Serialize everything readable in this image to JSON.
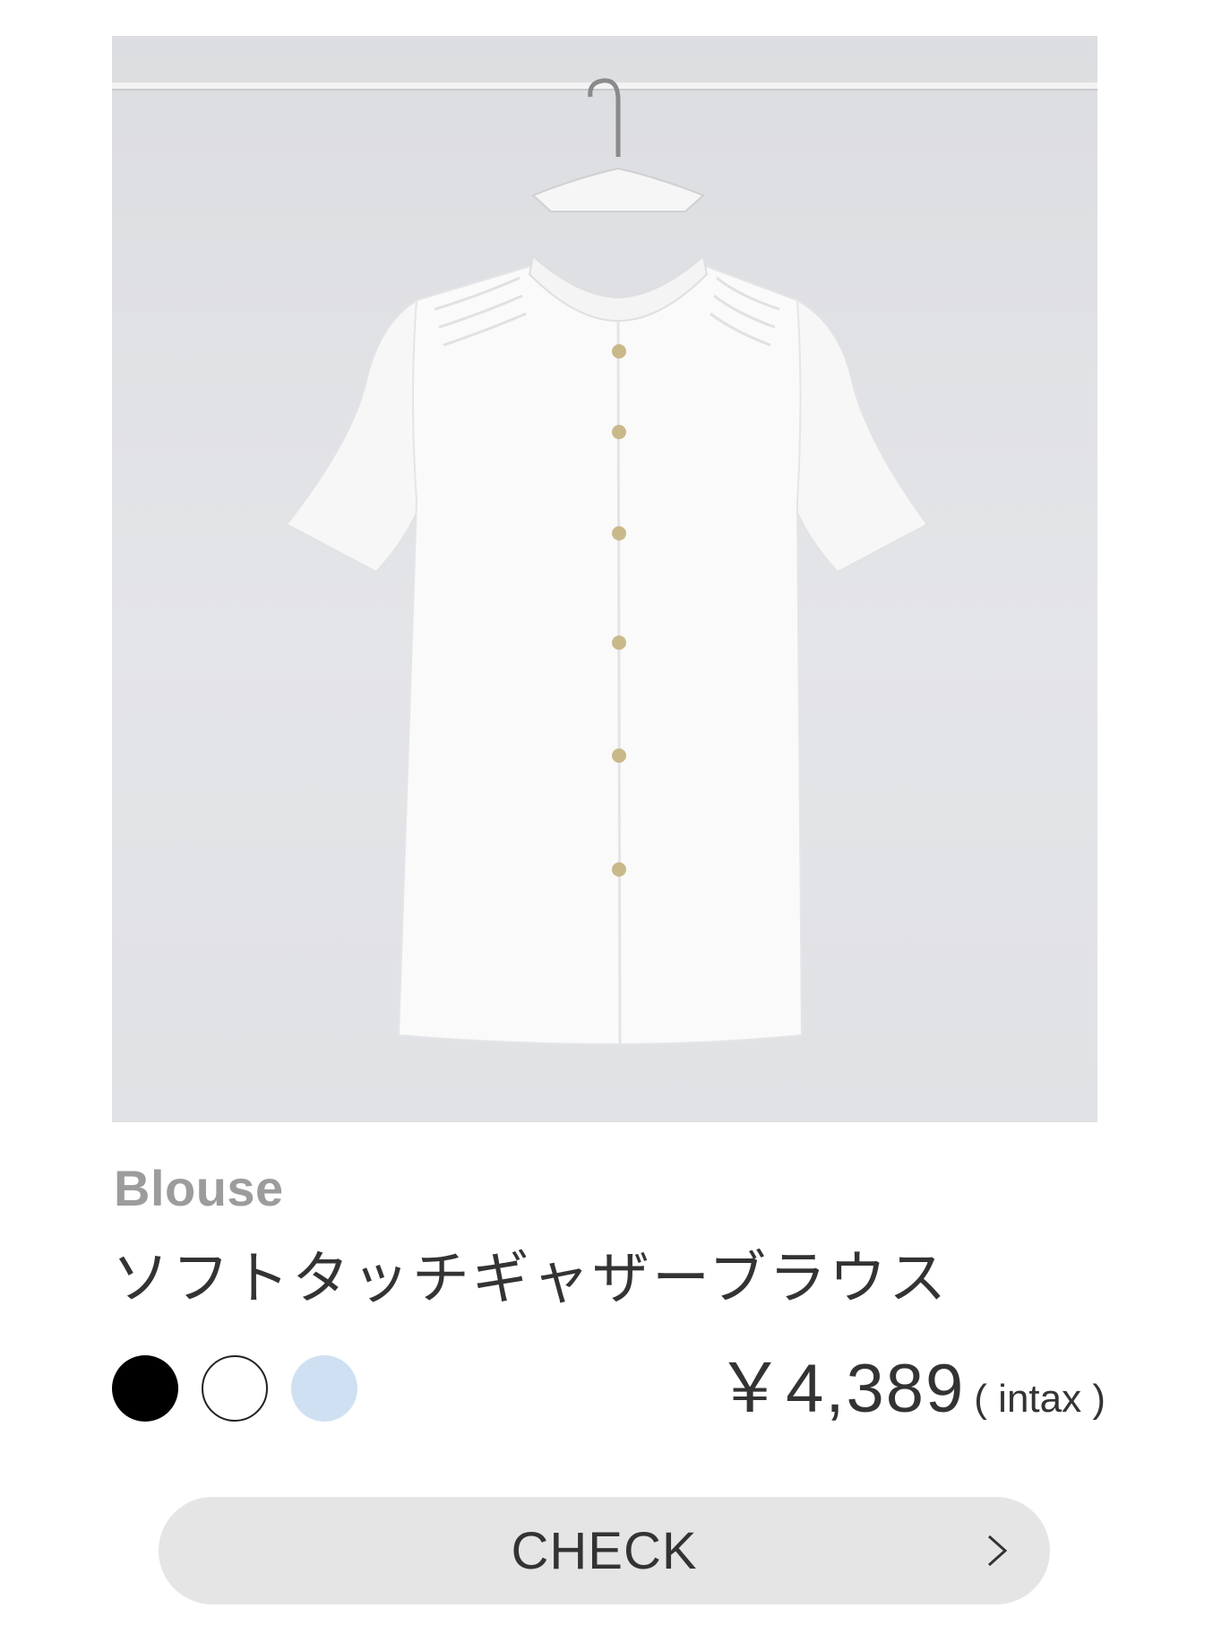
{
  "product": {
    "category": "Blouse",
    "name": "ソフトタッチギャザーブラウス",
    "image_icon": "white-blouse-on-hanger-photo",
    "colors": [
      {
        "name": "black",
        "hex": "#000000"
      },
      {
        "name": "white",
        "hex": "#ffffff"
      },
      {
        "name": "light-blue",
        "hex": "#cfe0f3"
      }
    ],
    "price": {
      "amount": "￥4,389",
      "tax_note": "( intax )"
    }
  },
  "cta": {
    "label": "CHECK",
    "icon": "chevron-right-icon"
  },
  "theme": {
    "category_color": "#9c9c9c",
    "text_color": "#333333",
    "button_bg": "#e5e5e5"
  }
}
